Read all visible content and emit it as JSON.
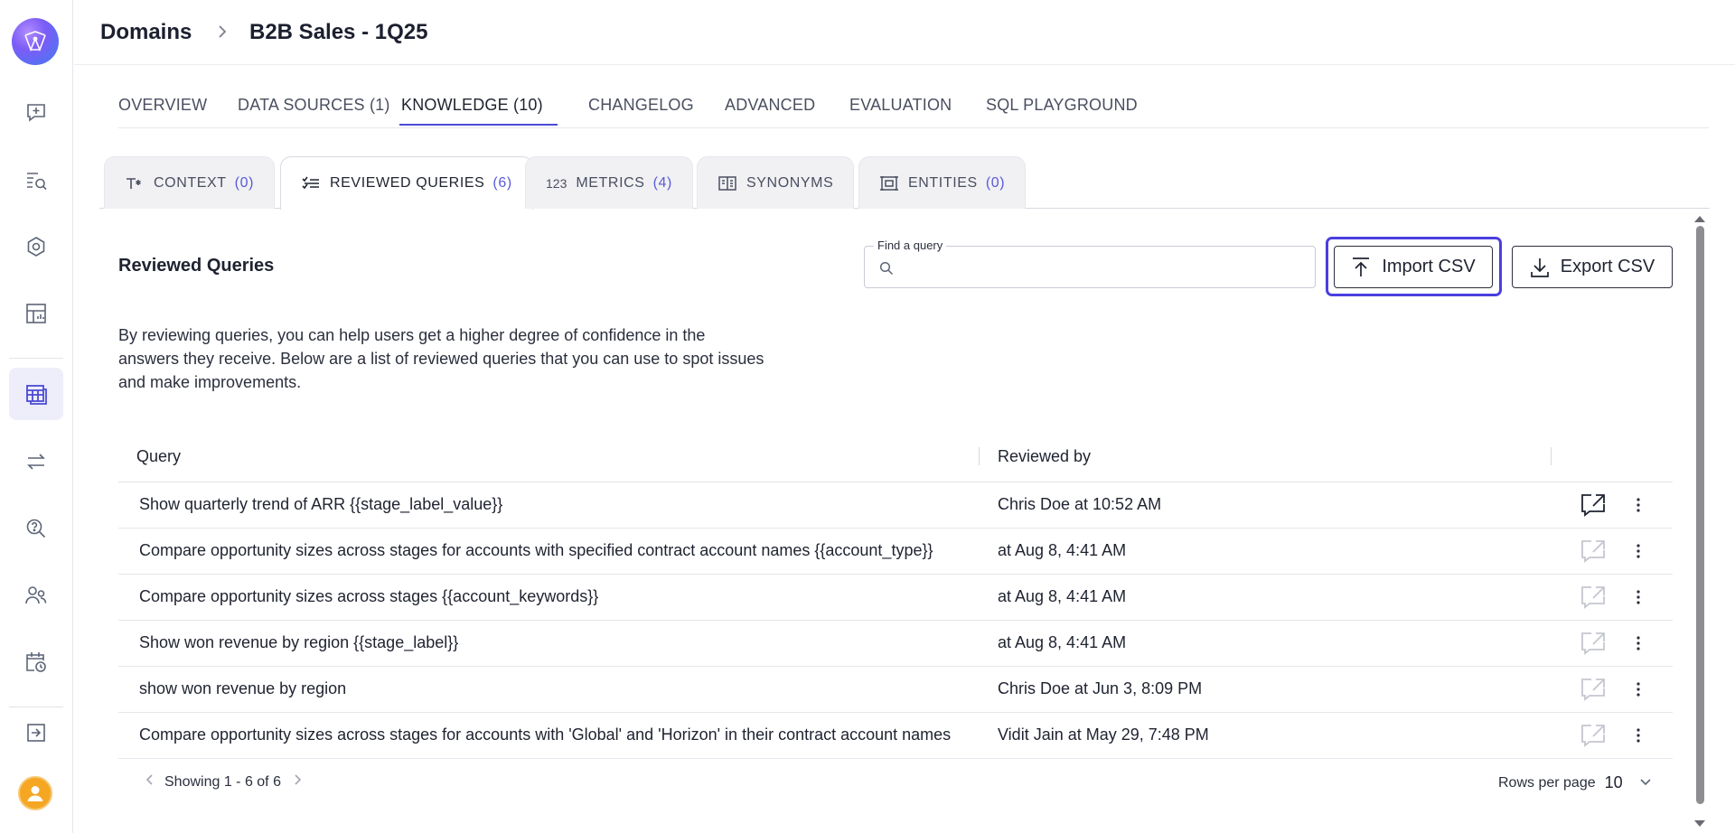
{
  "header": {
    "breadcrumb_root": "Domains",
    "breadcrumb_current": "B2B Sales - 1Q25"
  },
  "main_tabs": [
    {
      "label": "OVERVIEW"
    },
    {
      "label": "DATA SOURCES (1)"
    },
    {
      "label": "KNOWLEDGE (10)",
      "active": true
    },
    {
      "label": "CHANGELOG"
    },
    {
      "label": "ADVANCED"
    },
    {
      "label": "EVALUATION"
    },
    {
      "label": "SQL PLAYGROUND"
    }
  ],
  "sub_tabs": [
    {
      "label": "CONTEXT",
      "count": "(0)",
      "icon": "text-format-icon"
    },
    {
      "label": "REVIEWED QUERIES",
      "count": "(6)",
      "icon": "checklist-icon",
      "active": true
    },
    {
      "label": "METRICS",
      "count": "(4)",
      "icon": "numbers-icon"
    },
    {
      "label": "SYNONYMS",
      "count": "",
      "icon": "book-icon"
    },
    {
      "label": "ENTITIES",
      "count": "(0)",
      "icon": "entity-icon"
    }
  ],
  "section": {
    "title": "Reviewed Queries",
    "description": "By reviewing queries, you can help users get a higher degree of confidence in the answers they receive. Below are a list of reviewed queries that you can use to spot issues and make improvements."
  },
  "search": {
    "label": "Find a query",
    "value": "",
    "placeholder": ""
  },
  "actions": {
    "import_label": "Import CSV",
    "export_label": "Export CSV"
  },
  "table": {
    "columns": [
      "Query",
      "Reviewed by"
    ],
    "rows": [
      {
        "query": "Show quarterly trend of ARR {{stage_label_value}}",
        "reviewed_by": "Chris Doe at 10:52 AM",
        "open_enabled": true
      },
      {
        "query": "Compare opportunity sizes across stages for accounts with specified contract account names {{account_type}}",
        "reviewed_by": "at Aug 8, 4:41 AM",
        "open_enabled": false
      },
      {
        "query": "Compare opportunity sizes across stages {{account_keywords}}",
        "reviewed_by": "at Aug 8, 4:41 AM",
        "open_enabled": false
      },
      {
        "query": "Show won revenue by region {{stage_label}}",
        "reviewed_by": "at Aug 8, 4:41 AM",
        "open_enabled": false
      },
      {
        "query": "show won revenue by region",
        "reviewed_by": "Chris Doe at Jun 3, 8:09 PM",
        "open_enabled": false
      },
      {
        "query": "Compare opportunity sizes across stages for accounts with 'Global' and 'Horizon' in their contract account names",
        "reviewed_by": "Vidit Jain at May 29, 7:48 PM",
        "open_enabled": false
      }
    ]
  },
  "footer": {
    "showing": "Showing 1 - 6 of 6",
    "rows_per_page_label": "Rows per page",
    "rows_per_page_value": "10"
  },
  "colors": {
    "accent": "#4b4bd6",
    "focus_ring": "#4b3fe0",
    "avatar": "#f5a623"
  }
}
